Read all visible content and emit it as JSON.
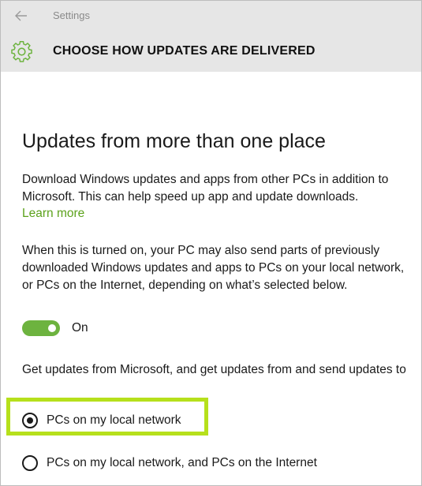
{
  "window": {
    "title": "Settings",
    "back_icon": "arrow-left-icon"
  },
  "header": {
    "icon": "gear-icon",
    "icon_color": "#6db33f",
    "title": "CHOOSE HOW UPDATES ARE DELIVERED"
  },
  "section": {
    "title": "Updates from more than one place",
    "intro": "Download Windows updates and apps from other PCs in addition to Microsoft. This can help speed up app and update downloads.",
    "learn_more": "Learn more",
    "description": "When this is turned on, your PC may also send parts of previously downloaded Windows updates and apps to PCs on your local network, or PCs on the Internet, depending on what’s selected below."
  },
  "toggle": {
    "state": "on",
    "label": "On",
    "color": "#6db33f"
  },
  "source": {
    "prompt": "Get updates from Microsoft, and get updates from and send updates to",
    "options": [
      {
        "label": "PCs on my local network",
        "selected": true
      },
      {
        "label": "PCs on my local network, and PCs on the Internet",
        "selected": false
      }
    ],
    "highlight_color": "#b6e01c"
  },
  "colors": {
    "accent": "#6db33f",
    "link": "#5ca21c",
    "header_bg": "#e6e6e6"
  }
}
